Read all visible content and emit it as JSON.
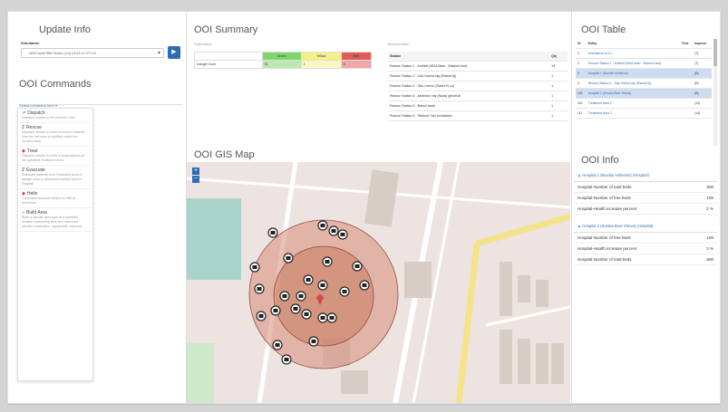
{
  "left": {
    "title": "Update Info",
    "sim_label": "Simulation",
    "sim_value": "MSM world IBM Version (V3) (2013-01-07T4:0",
    "commands_title": "OOI Commands",
    "select_placeholder": "Select command here ▾",
    "commands": [
      {
        "icon": "↗",
        "name": "Dispatch",
        "desc": "Dispatch vehicle to the selected Vest"
      },
      {
        "icon": "Z",
        "name": "Rescue",
        "desc": "Dispatch vehicle in order to rescue Patients from the red zone to another within the Incident area"
      },
      {
        "icon": "◆",
        "name": "Treat",
        "desc": "Dispatch vehicle in order to treat patients at the specified Treatment Area"
      },
      {
        "icon": "Z",
        "name": "Evacuate",
        "desc": "Evacuate patients from Treatment Area or danger zone to advanced medical post or Hospital"
      },
      {
        "icon": "◆",
        "name": "Hello",
        "desc": "Command resource behind to refill its resources"
      },
      {
        "icon": "●",
        "name": "Build Area",
        "desc": "Build a specific area type at a specified location consuming time and resources (shelter, evacuation, equipment, volumes)"
      }
    ]
  },
  "summary": {
    "title": "OOI Summary",
    "patient_label": "Patient status",
    "resource_label": "Resource status",
    "headers": [
      "",
      "Green",
      "Yellow",
      "Red"
    ],
    "rows": [
      [
        "Danger Zone",
        "51",
        "1",
        "6"
      ]
    ],
    "res_headers": [
      "Station",
      "Qty"
    ],
    "res_rows": [
      [
        "Rescue Station 1 - Ambinit (MDA Main - Wisdom bed)",
        "14"
      ],
      [
        "Rescue Station 2 - Gan Hanna city (Ramat Aj)",
        "1"
      ],
      [
        "Rescue Station 3 - Gan Lemon (Saber El co)",
        "1"
      ],
      [
        "Rescue Station 4 - Ashkelon city (Ndas) giborit-bl",
        "1"
      ],
      [
        "Rescue Station 5 - Barsul bank",
        "1"
      ],
      [
        "Rescue Station 6 - Ribbon2 Tan Ironbashel",
        "1"
      ]
    ]
  },
  "map": {
    "title": "OOI GIS Map",
    "zoom_in": "+",
    "zoom_out": "−"
  },
  "table": {
    "title": "OOI Table",
    "headers": [
      "ID",
      "Entity",
      "Time",
      "Improve"
    ],
    "rows": [
      {
        "id": "1",
        "entity": "Ambulance ALS-1",
        "val": "(T)",
        "sel": false
      },
      {
        "id": "2",
        "entity": "Rescue Station 1 - Ambinit (MDA Main - Wisdom bed)",
        "val": "(T)",
        "sel": false
      },
      {
        "id": "3",
        "entity": "Hospital 1 (Barzilai Ashkelon)",
        "val": "(B)",
        "sel": true
      },
      {
        "id": "4",
        "entity": "Rescue Station 2 - Gan Hanna city (Ramat Aj)",
        "val": "(B)",
        "sel": false
      },
      {
        "id": "101",
        "entity": "Hospital 2 (Soroka Beer Sheva)",
        "val": "(B)",
        "sel": true
      },
      {
        "id": "110",
        "entity": "Treatment Area 1",
        "val": "(14)",
        "sel": false
      },
      {
        "id": "111",
        "entity": "Treatment Area 2",
        "val": "(14)",
        "sel": false
      }
    ]
  },
  "info": {
    "title": "OOI Info",
    "group1": "Hospital 1 (Barzilai Ashkelon) (Hospital)",
    "rows1": [
      [
        "Hospital-Number of total beds",
        "500"
      ],
      [
        "Hospital-Number of free beds",
        "100"
      ],
      [
        "Hospital-Health increase percent",
        "2 %"
      ]
    ],
    "group2": "Hospital 2 (Soroka Beer Sheva) (Hospital)",
    "rows2": [
      [
        "Hospital-Number of free beds",
        "100"
      ],
      [
        "Hospital-Health increase percent",
        "2 %"
      ],
      [
        "Hospital-Number of total beds",
        "500"
      ]
    ]
  },
  "colors": {
    "accent": "#2e6bb5",
    "green": "#7fd66e",
    "yellow": "#f3f28a",
    "red": "#e05a5a"
  }
}
